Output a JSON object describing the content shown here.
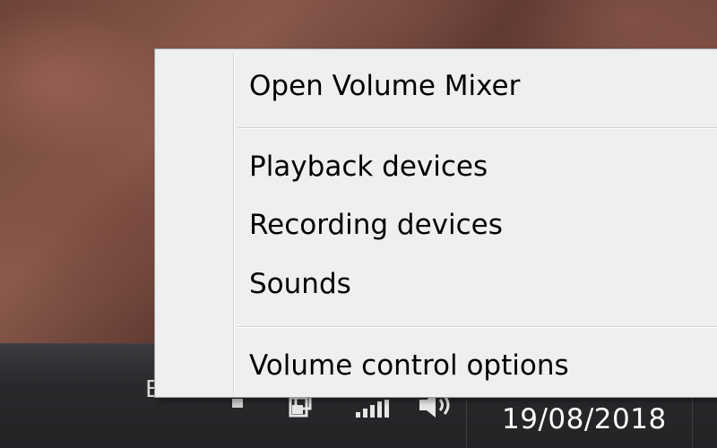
{
  "context_menu": {
    "items": [
      {
        "label": "Open Volume Mixer"
      },
      {
        "label": "Playback devices"
      },
      {
        "label": "Recording devices"
      },
      {
        "label": "Sounds"
      },
      {
        "label": "Volume control options"
      }
    ]
  },
  "taskbar": {
    "partial_label": "E",
    "date": "19/08/2018",
    "tray_icons": [
      "action-center-icon",
      "network-icon",
      "volume-icon"
    ]
  },
  "colors": {
    "menu_background": "#efefef",
    "menu_border": "#9b9b9b",
    "taskbar": "#2a282b",
    "clock_text": "#ffffff"
  }
}
